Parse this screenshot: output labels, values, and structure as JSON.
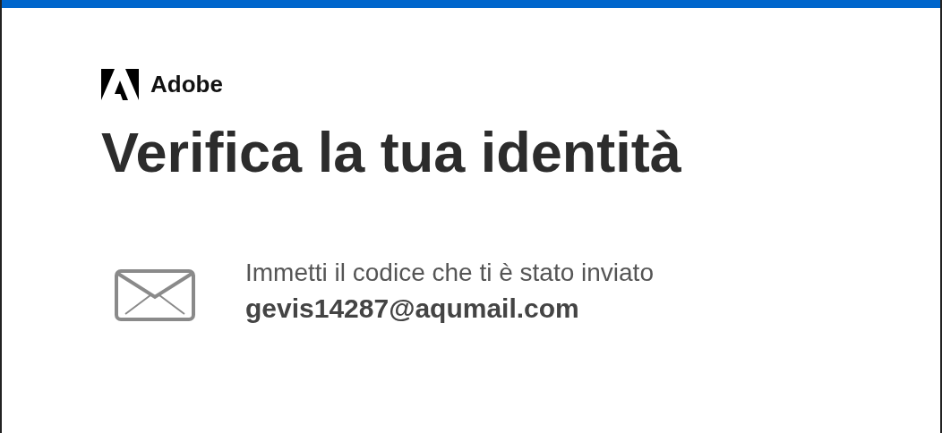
{
  "brand": {
    "name": "Adobe"
  },
  "heading": "Verifica la tua identità",
  "message": {
    "text": "Immetti il codice che ti è stato inviato",
    "email": "gevis14287@aqumail.com"
  }
}
